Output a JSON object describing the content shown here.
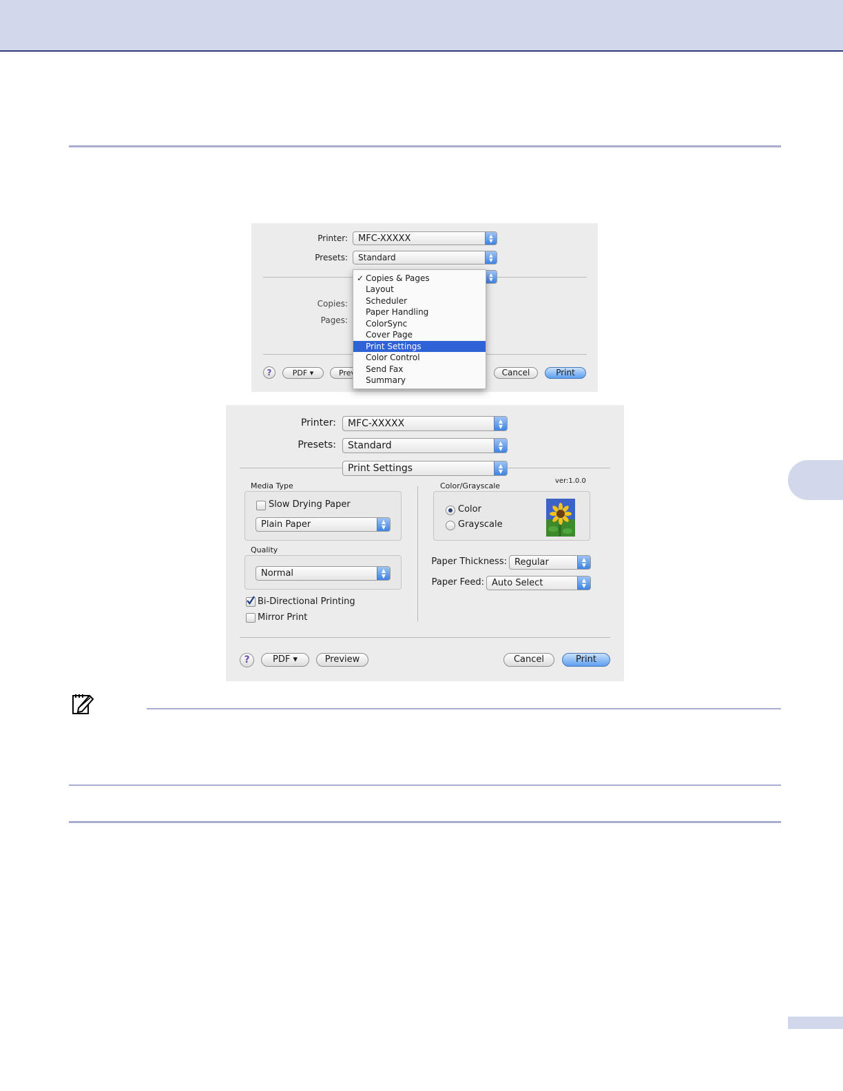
{
  "dialog1": {
    "printer_label": "Printer:",
    "printer_value": "MFC-XXXXX",
    "presets_label": "Presets:",
    "presets_value": "Standard",
    "copies_label": "Copies:",
    "pages_label": "Pages:",
    "menu": {
      "checkmark": "✓",
      "items": [
        "Copies & Pages",
        "Layout",
        "Scheduler",
        "Paper Handling",
        "ColorSync",
        "Cover Page",
        "Print Settings",
        "Color Control",
        "Send Fax",
        "Summary"
      ],
      "checked_item": "Copies & Pages",
      "highlighted_item": "Print Settings"
    },
    "help_label": "?",
    "pdf_label": "PDF ▾",
    "preview_partial": "Prev",
    "cancel_label": "Cancel",
    "print_label": "Print"
  },
  "dialog2": {
    "printer_label": "Printer:",
    "printer_value": "MFC-XXXXX",
    "presets_label": "Presets:",
    "presets_value": "Standard",
    "panel_value": "Print Settings",
    "media_type_label": "Media Type",
    "slow_drying_label": "Slow Drying Paper",
    "slow_drying_checked": false,
    "media_value": "Plain Paper",
    "quality_label": "Quality",
    "quality_value": "Normal",
    "bidirectional_label": "Bi-Directional Printing",
    "bidirectional_checked": true,
    "mirror_label": "Mirror Print",
    "mirror_checked": false,
    "color_grayscale_label": "Color/Grayscale",
    "version": "ver:1.0.0",
    "color_label": "Color",
    "grayscale_label": "Grayscale",
    "selected_mode": "Color",
    "paper_thickness_label": "Paper Thickness:",
    "paper_thickness_value": "Regular",
    "paper_feed_label": "Paper Feed:",
    "paper_feed_value": "Auto Select",
    "help_label": "?",
    "pdf_label": "PDF ▾",
    "preview_label": "Preview",
    "cancel_label": "Cancel",
    "print_label": "Print"
  },
  "colors": {
    "header_band": "#d2d8eb",
    "accent_blue": "#2f62d6",
    "rule": "#a9aed0"
  },
  "icons": {
    "note": "note-pencil-icon",
    "sunflower": "sunflower-image"
  }
}
